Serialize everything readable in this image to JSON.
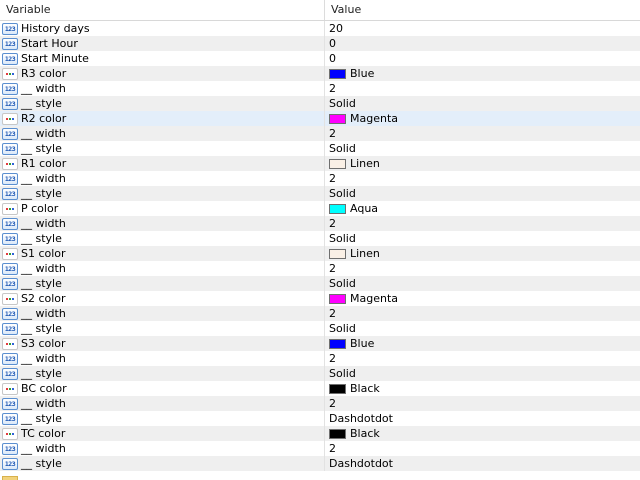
{
  "header": {
    "variable": "Variable",
    "value": "Value"
  },
  "icon_labels": {
    "numeric": "123"
  },
  "rows": [
    {
      "icon": "numeric",
      "name": "History days",
      "value": "20"
    },
    {
      "icon": "numeric",
      "name": "Start Hour",
      "value": "0"
    },
    {
      "icon": "numeric",
      "name": "Start Minute",
      "value": "0"
    },
    {
      "icon": "color",
      "name": "R3 color",
      "value": "Blue",
      "swatch": "#0000ff"
    },
    {
      "icon": "numeric",
      "name": "__ width",
      "value": "2"
    },
    {
      "icon": "numeric",
      "name": "__ style",
      "value": "Solid"
    },
    {
      "icon": "color",
      "name": "R2 color",
      "value": "Magenta",
      "swatch": "#ff00ff",
      "selected": true
    },
    {
      "icon": "numeric",
      "name": "__ width",
      "value": "2"
    },
    {
      "icon": "numeric",
      "name": "__ style",
      "value": "Solid"
    },
    {
      "icon": "color",
      "name": "R1 color",
      "value": "Linen",
      "swatch": "#faf0e6"
    },
    {
      "icon": "numeric",
      "name": "__ width",
      "value": "2"
    },
    {
      "icon": "numeric",
      "name": "__ style",
      "value": "Solid"
    },
    {
      "icon": "color",
      "name": "P color",
      "value": "Aqua",
      "swatch": "#00ffff"
    },
    {
      "icon": "numeric",
      "name": "__ width",
      "value": "2"
    },
    {
      "icon": "numeric",
      "name": "__ style",
      "value": "Solid"
    },
    {
      "icon": "color",
      "name": "S1 color",
      "value": "Linen",
      "swatch": "#faf0e6"
    },
    {
      "icon": "numeric",
      "name": "__ width",
      "value": "2"
    },
    {
      "icon": "numeric",
      "name": "__ style",
      "value": "Solid"
    },
    {
      "icon": "color",
      "name": "S2 color",
      "value": "Magenta",
      "swatch": "#ff00ff"
    },
    {
      "icon": "numeric",
      "name": "__ width",
      "value": "2"
    },
    {
      "icon": "numeric",
      "name": "__ style",
      "value": "Solid"
    },
    {
      "icon": "color",
      "name": "S3 color",
      "value": "Blue",
      "swatch": "#0000ff"
    },
    {
      "icon": "numeric",
      "name": "__ width",
      "value": "2"
    },
    {
      "icon": "numeric",
      "name": "__ style",
      "value": "Solid"
    },
    {
      "icon": "color",
      "name": "BC color",
      "value": "Black",
      "swatch": "#000000"
    },
    {
      "icon": "numeric",
      "name": "__ width",
      "value": "2"
    },
    {
      "icon": "numeric",
      "name": "__ style",
      "value": "Dashdotdot"
    },
    {
      "icon": "color",
      "name": "TC color",
      "value": "Black",
      "swatch": "#000000"
    },
    {
      "icon": "numeric",
      "name": "__ width",
      "value": "2"
    },
    {
      "icon": "numeric",
      "name": "__ style",
      "value": "Dashdotdot"
    }
  ]
}
